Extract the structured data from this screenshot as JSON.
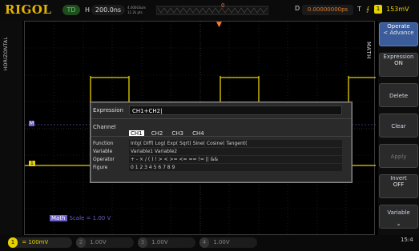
{
  "header": {
    "brand": "RIGOL",
    "run_status": "TD",
    "horizontal_label": "H",
    "timebase": "200.0ns",
    "sample_rate": "4.000GSa/s",
    "memory_depth": "11.2k pts",
    "trigger_marker": "0",
    "delay_label": "D",
    "trigger_offset": "0.00000000ps",
    "trigger_type_label": "T",
    "trigger_channel": "1",
    "trigger_level": "153mV",
    "trigger_glyph": "▼"
  },
  "left_strip": {
    "mode": "HORIZONTAL"
  },
  "math_strip": {
    "label": "MATH"
  },
  "softkeys": [
    {
      "label": "Operate",
      "value": "< Advance"
    },
    {
      "label": "Expression",
      "value": "ON"
    },
    {
      "label": "Delete",
      "value": ""
    },
    {
      "label": "Clear",
      "value": ""
    },
    {
      "label": "Apply",
      "value": ""
    },
    {
      "label": "Invert",
      "value": "OFF"
    },
    {
      "label": "Variable",
      "value": ""
    }
  ],
  "dialog": {
    "expression_label": "Expression",
    "expression_value": "CH1+CH2",
    "channel_label": "Channel",
    "channels": [
      "CH1",
      "CH2",
      "CH3",
      "CH4"
    ],
    "selected_channel": "CH1",
    "function_label": "Function",
    "functions": "Intg(  Diff(  Log(  Exp(  Sqrt(  Sine(  Cosine(  Tangent(",
    "variable_label": "Variable",
    "variables": "Variable1  Variable2",
    "operator_label": "Operator",
    "operators": "+ - × / ( ) ! > < >= <= == != || &&",
    "figure_label": "Figure",
    "figures": "0 1 2 3 4 5 6 7 8 9"
  },
  "math_readout": {
    "tag": "Math",
    "scale": "Scale = 1.00 V"
  },
  "bottom": {
    "ch1_num": "1",
    "ch1_scale": "= 100mV",
    "ch2_num": "2",
    "ch2_scale": "1.00V",
    "ch3_num": "3",
    "ch3_scale": "1.00V",
    "ch4_num": "4",
    "ch4_scale": "1.00V",
    "time": "15:4"
  },
  "colors": {
    "ch1": "#e6d200",
    "math": "#6a5fc8",
    "trigger": "#ff7a2a",
    "brand": "#e6b400"
  }
}
